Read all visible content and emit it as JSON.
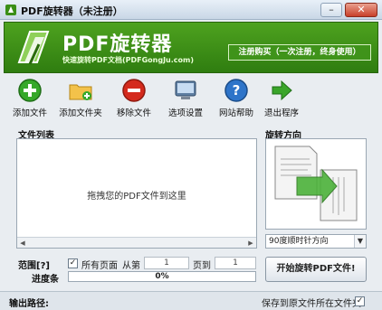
{
  "window": {
    "title": "PDF旋转器（未注册）",
    "minimize": "–",
    "close": "✕"
  },
  "header": {
    "title": "PDF旋转器",
    "subtitle": "快速旋转PDF文档(PDFGongJu.com)",
    "register_button": "注册购买（一次注册，终身使用）"
  },
  "toolbar": {
    "items": [
      {
        "label": "添加文件",
        "icon": "add-file-icon"
      },
      {
        "label": "添加文件夹",
        "icon": "add-folder-icon"
      },
      {
        "label": "移除文件",
        "icon": "remove-file-icon"
      },
      {
        "label": "选项设置",
        "icon": "settings-monitor-icon"
      },
      {
        "label": "网站帮助",
        "icon": "help-icon"
      },
      {
        "label": "退出程序",
        "icon": "exit-arrow-icon"
      }
    ]
  },
  "file_list": {
    "label": "文件列表",
    "drop_hint": "拖拽您的PDF文件到这里"
  },
  "rotation": {
    "label": "旋转方向",
    "selected": "90度顺时针方向"
  },
  "range": {
    "label": "范围[?]",
    "all_pages_label": "所有页面",
    "all_pages_checked": true,
    "from_label": "从第",
    "from_value": "1",
    "to_label": "页到",
    "to_value": "1"
  },
  "progress": {
    "label": "进度条",
    "value_text": "0%",
    "value": 0
  },
  "start_button": "开始旋转PDF文件!",
  "output": {
    "label": "输出路径:",
    "save_to_source_label": "保存到原文件所在文件夹",
    "save_to_source_checked": true
  },
  "colors": {
    "header_green": "#3a8e16",
    "add_green": "#36a82a",
    "remove_red": "#d42a1d",
    "help_blue": "#2e74c9"
  }
}
